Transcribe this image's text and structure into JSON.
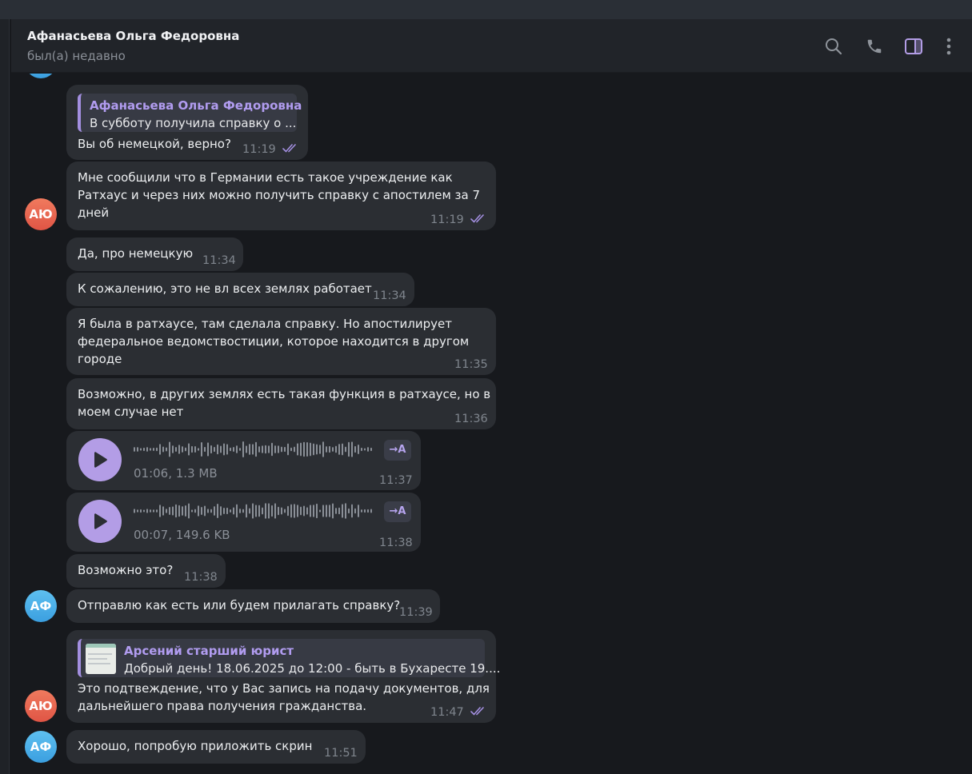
{
  "header": {
    "contact_name": "Афанасьева Ольга Федоровна",
    "status": "был(а) недавно"
  },
  "colors": {
    "accent": "#a38fe0",
    "bubble": "#2b2e33",
    "background": "#17191d"
  },
  "messages": [
    {
      "reply_name": "Афанасьева Ольга Федоровна",
      "reply_text": "В субботу получила справку о ...",
      "text": "Вы об немецкой, верно?",
      "time": "11:19"
    },
    {
      "avatar": "АЮ",
      "lines": [
        "Мне сообщили что в Германии есть такое учреждение как",
        "Ратхаус и через них можно получить справку с апостилем за 7",
        "дней"
      ],
      "time": "11:19"
    },
    {
      "text": "Да, про немецкую",
      "time": "11:34"
    },
    {
      "text": "К сожалению, это не вл всех землях работает",
      "time": "11:34"
    },
    {
      "lines": [
        "Я была в ратхаусе, там сделала справку. Но апостилирует",
        "федеральное ведомствостиции, которое находится в другом",
        "городе"
      ],
      "time": "11:35"
    },
    {
      "lines": [
        "Возможно, в других землях есть такая функция в ратхаусе, но в",
        "моем случае нет"
      ],
      "time": "11:36"
    },
    {
      "voice_meta": "01:06, 1.3 MB",
      "transcribe_label": "→A",
      "time": "11:37"
    },
    {
      "voice_meta": "00:07, 149.6 KB",
      "transcribe_label": "→A",
      "time": "11:38"
    },
    {
      "text": "Возможно это?",
      "time": "11:38"
    },
    {
      "avatar": "АФ",
      "text": "Отправлю как есть или будем прилагать справку?",
      "time": "11:39"
    },
    {
      "avatar": "АЮ",
      "reply_name": "Арсений старший юрист",
      "reply_text": "Добрый день! 18.06.2025 до 12:00 - быть в Бухаресте 19....",
      "lines": [
        "Это подтвеждение, что у Вас запись на подачу документов, для",
        "дальнейшего права получения гражданства."
      ],
      "time": "11:47"
    },
    {
      "avatar": "АФ",
      "text": "Хорошо, попробую приложить скрин",
      "time": "11:51"
    }
  ]
}
